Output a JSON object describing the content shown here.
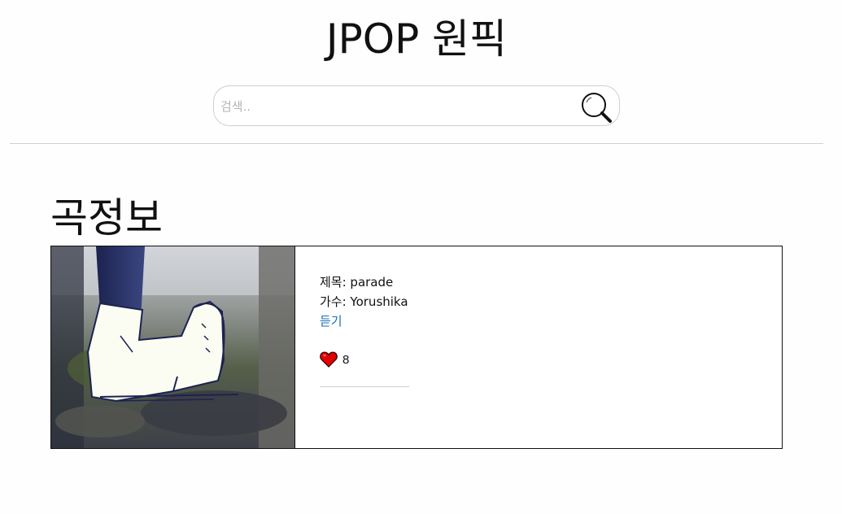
{
  "header": {
    "title": "JPOP 원픽",
    "search_placeholder": "검색.."
  },
  "icons": {
    "search": "search-icon",
    "heart": "heart-icon"
  },
  "section": {
    "title": "곡정보"
  },
  "song": {
    "title_line": "제목: parade",
    "artist_line": "가수: Yorushika",
    "listen_label": "듣기",
    "likes": "8"
  },
  "colors": {
    "link": "#1a6fb0",
    "heart": "#e00000",
    "card_border": "#111111"
  }
}
